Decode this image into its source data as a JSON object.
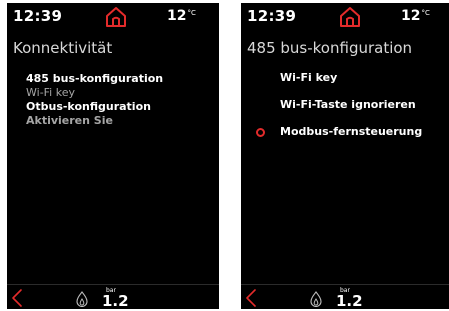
{
  "colors": {
    "accent": "#e32b2b",
    "screen_background": "#000000",
    "text_primary": "#ffffff",
    "text_dimmed": "#a5a5a5"
  },
  "screens": [
    {
      "status": {
        "time": "12:39",
        "temperature": "12",
        "temperature_unit": "°C",
        "home_icon": "home-icon"
      },
      "title": "Konnektivität",
      "menu_items": [
        "485 bus-konfiguration",
        "Wi-Fi key",
        "Otbus-konfiguration",
        "Aktivieren Sie"
      ],
      "footer": {
        "back_icon": "chevron-left-icon",
        "flame_icon": "flame-icon",
        "pressure_unit": "bar",
        "pressure_value": "1.2"
      }
    },
    {
      "status": {
        "time": "12:39",
        "temperature": "12",
        "temperature_unit": "°C",
        "home_icon": "home-icon"
      },
      "title": "485 bus-konfiguration",
      "options": [
        {
          "label": "Wi-Fi key",
          "selected": false
        },
        {
          "label": "Wi-Fi-Taste ignorieren",
          "selected": false
        },
        {
          "label": "Modbus-fernsteuerung",
          "selected": true
        }
      ],
      "footer": {
        "back_icon": "chevron-left-icon",
        "flame_icon": "flame-icon",
        "pressure_unit": "bar",
        "pressure_value": "1.2"
      }
    }
  ]
}
